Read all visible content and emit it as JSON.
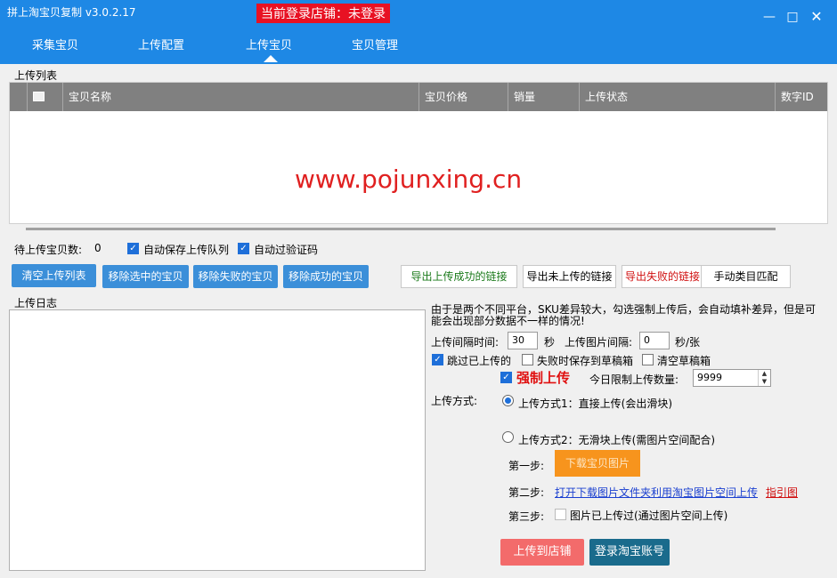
{
  "window": {
    "title": "拼上淘宝贝复制 v3.0.2.17",
    "login_status": "当前登录店铺：未登录",
    "min_icon": "minimize-icon",
    "max_icon": "maximize-icon",
    "close_icon": "close-icon"
  },
  "nav": {
    "tabs": [
      {
        "label": "采集宝贝"
      },
      {
        "label": "上传配置"
      },
      {
        "label": "上传宝贝"
      },
      {
        "label": "宝贝管理"
      }
    ],
    "active_index": 2
  },
  "upload_list": {
    "label": "上传列表",
    "columns": [
      "宝贝名称",
      "宝贝价格",
      "销量",
      "上传状态",
      "数字ID"
    ],
    "watermark": "www.pojunxing.cn"
  },
  "controls": {
    "pending_label": "待上传宝贝数:",
    "pending_count": "0",
    "auto_save_queue": "自动保存上传队列",
    "auto_captcha": "自动过验证码",
    "buttons": {
      "clear_list": "清空上传列表",
      "remove_selected": "移除选中的宝贝",
      "remove_failed": "移除失败的宝贝",
      "remove_success": "移除成功的宝贝",
      "export_success": "导出上传成功的链接",
      "export_unuploaded": "导出未上传的链接",
      "export_failed": "导出失败的链接",
      "manual_category": "手动类目匹配"
    }
  },
  "log": {
    "label": "上传日志"
  },
  "settings": {
    "notice_line1": "由于是两个不同平台，SKU差异较大，勾选强制上传后，会自动填补差异，但是可",
    "notice_line2": "能会出现部分数据不一样的情况!",
    "interval_label": "上传间隔时间:",
    "interval_value": "30",
    "interval_unit": "秒",
    "img_interval_label": "上传图片间隔:",
    "img_interval_value": "0",
    "img_interval_unit": "秒/张",
    "skip_uploaded": "跳过已上传的",
    "save_draft_on_fail": "失败时保存到草稿箱",
    "clear_draft": "清空草稿箱",
    "force_upload": "强制上传",
    "daily_limit_label": "今日限制上传数量:",
    "daily_limit_value": "9999",
    "method_label": "上传方式:",
    "method1": "上传方式1：直接上传(会出滑块)",
    "method2": "上传方式2：无滑块上传(需图片空间配合)",
    "step1_label": "第一步:",
    "step1_button": "下载宝贝图片",
    "step2_label": "第二步:",
    "step2_link": "打开下载图片文件夹利用淘宝图片空间上传",
    "step2_guide": "指引图",
    "step3_label": "第三步:",
    "step3_check": "图片已上传过(通过图片空间上传)",
    "upload_store": "上传到店铺",
    "login_taobao": "登录淘宝账号"
  },
  "colors": {
    "accent": "#1e88e5",
    "danger": "#e81123",
    "orange": "#f7941d"
  }
}
